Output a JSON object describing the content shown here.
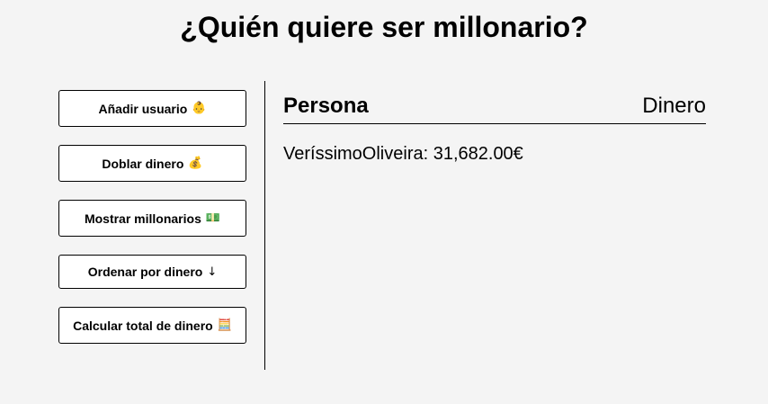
{
  "page": {
    "title": "¿Quién quiere ser millonario?"
  },
  "sidebar": {
    "buttons": [
      {
        "label": "Añadir usuario",
        "icon": "👶",
        "icon_name": "baby-face-icon"
      },
      {
        "label": "Doblar dinero",
        "icon": "💰",
        "icon_name": "money-bag-icon"
      },
      {
        "label": "Mostrar millonarios",
        "icon": "💵",
        "icon_name": "dollar-banknote-icon"
      },
      {
        "label": "Ordenar por dinero",
        "icon": "↓",
        "icon_name": "arrow-down-icon"
      },
      {
        "label": "Calcular total de dinero",
        "icon": "🧮",
        "icon_name": "abacus-icon"
      }
    ]
  },
  "main": {
    "header": {
      "persona": "Persona",
      "dinero": "Dinero"
    },
    "rows": [
      {
        "text": "VeríssimoOliveira: 31,682.00€"
      }
    ]
  }
}
